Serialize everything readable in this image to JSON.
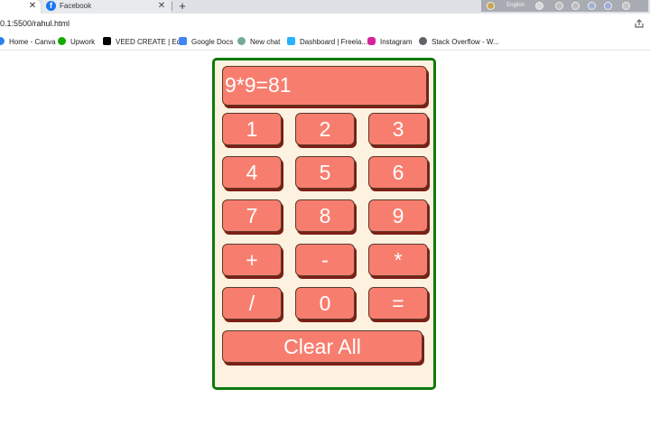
{
  "browser": {
    "tabs": [
      {
        "title": "",
        "close": "✕"
      },
      {
        "title": "Facebook",
        "close": "✕"
      }
    ],
    "new_tab": "+",
    "extensions_label": "English",
    "url": "0.1:5500/rahul.html",
    "bookmarks": [
      {
        "label": "Home - Canva",
        "color": "#2f80ed"
      },
      {
        "label": "Upwork",
        "color": "#14a800"
      },
      {
        "label": "VEED CREATE | Edit",
        "color": "#000000"
      },
      {
        "label": "Google Docs",
        "color": "#4285f4"
      },
      {
        "label": "New chat",
        "color": "#74aa9c"
      },
      {
        "label": "Dashboard | Freela...",
        "color": "#29b2fe"
      },
      {
        "label": "Instagram",
        "color": "#d6249f"
      },
      {
        "label": "Stack Overflow - W...",
        "color": "#5f6368"
      }
    ]
  },
  "calculator": {
    "display": "9*9=81",
    "keys": [
      "1",
      "2",
      "3",
      "4",
      "5",
      "6",
      "7",
      "8",
      "9",
      "+",
      "-",
      "*",
      "/",
      "0",
      "="
    ],
    "clear_label": "Clear All",
    "colors": {
      "border": "#0e7a0d",
      "background": "#fdf1e0",
      "key": "#f77e6f",
      "shadow": "#7b1f14"
    }
  }
}
